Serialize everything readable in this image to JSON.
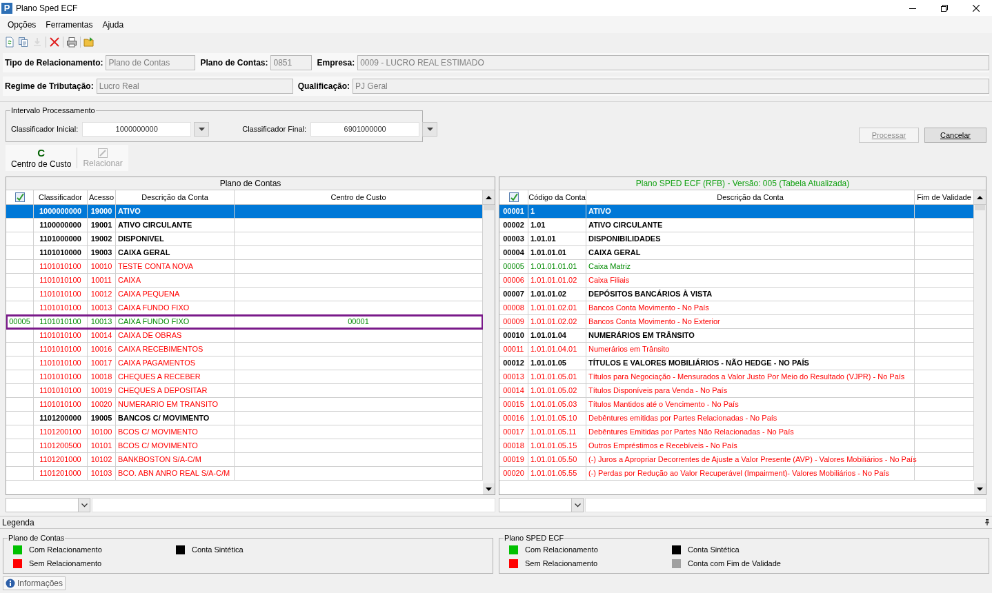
{
  "window": {
    "title": "Plano Sped ECF",
    "logo": "P"
  },
  "menu": [
    "Opções",
    "Ferramentas",
    "Ajuda"
  ],
  "toolbar": [
    {
      "kind": "refresh",
      "disabled": false
    },
    {
      "kind": "copy",
      "disabled": false
    },
    {
      "kind": "download",
      "disabled": true
    },
    {
      "kind": "delete",
      "disabled": false
    },
    {
      "kind": "print",
      "disabled": false
    },
    {
      "kind": "open",
      "disabled": false
    }
  ],
  "header_rows": [
    [
      {
        "label": "Tipo de Relacionamento:",
        "value": "Plano de Contas"
      },
      {
        "label": "Plano de Contas:",
        "value": "0851"
      },
      {
        "label": "Empresa:",
        "value": "0009 - LUCRO REAL ESTIMADO"
      }
    ],
    [
      {
        "label": "Regime de Tributação:",
        "value": "Lucro Real"
      },
      {
        "label": "Qualificação:",
        "value": "PJ Geral"
      }
    ]
  ],
  "interval": {
    "title": "Intervalo Processamento",
    "fields": [
      {
        "label": "Classificador Inicial:",
        "value": "1000000000"
      },
      {
        "label": "Classificador Final:",
        "value": "6901000000"
      }
    ]
  },
  "actions": [
    {
      "label": "Processar",
      "disabled": true
    },
    {
      "label": "Cancelar",
      "disabled": false
    }
  ],
  "tools": [
    {
      "kind": "glyph",
      "glyph": "C",
      "label": "Centro de Custo",
      "disabled": false
    },
    {
      "kind": "icon",
      "label": "Relacionar",
      "disabled": true
    }
  ],
  "left_table": {
    "title": "Plano de Contas",
    "columns": [
      "",
      "Classificador",
      "Acesso",
      "Descrição da Conta",
      "Centro de Custo"
    ],
    "rows": [
      {
        "kind": "synthetic",
        "selected": true,
        "cells": [
          "",
          "1000000000",
          "19000",
          "ATIVO",
          ""
        ]
      },
      {
        "kind": "synthetic",
        "selected": false,
        "cells": [
          "",
          "1100000000",
          "19001",
          "ATIVO CIRCULANTE",
          ""
        ]
      },
      {
        "kind": "synthetic",
        "selected": false,
        "cells": [
          "",
          "1101000000",
          "19002",
          "DISPONIVEL",
          ""
        ]
      },
      {
        "kind": "synthetic",
        "selected": false,
        "cells": [
          "",
          "1101010000",
          "19003",
          "CAIXA GERAL",
          ""
        ]
      },
      {
        "kind": "unrelated",
        "selected": false,
        "cells": [
          "",
          "1101010100",
          "10010",
          "TESTE CONTA NOVA",
          ""
        ]
      },
      {
        "kind": "unrelated",
        "selected": false,
        "cells": [
          "",
          "1101010100",
          "10011",
          "CAIXA",
          ""
        ]
      },
      {
        "kind": "unrelated",
        "selected": false,
        "cells": [
          "",
          "1101010100",
          "10012",
          "CAIXA PEQUENA",
          ""
        ]
      },
      {
        "kind": "unrelated",
        "selected": false,
        "cells": [
          "",
          "1101010100",
          "10013",
          "CAIXA FUNDO FIXO",
          ""
        ]
      },
      {
        "kind": "editing",
        "selected": false,
        "cells": [
          "00005",
          "1101010100",
          "10013",
          "CAIXA FUNDO FIXO",
          "00001"
        ]
      },
      {
        "kind": "unrelated",
        "selected": false,
        "cells": [
          "",
          "1101010100",
          "10014",
          "CAIXA DE OBRAS",
          ""
        ]
      },
      {
        "kind": "unrelated",
        "selected": false,
        "cells": [
          "",
          "1101010100",
          "10016",
          "CAIXA RECEBIMENTOS",
          ""
        ]
      },
      {
        "kind": "unrelated",
        "selected": false,
        "cells": [
          "",
          "1101010100",
          "10017",
          "CAIXA PAGAMENTOS",
          ""
        ]
      },
      {
        "kind": "unrelated",
        "selected": false,
        "cells": [
          "",
          "1101010100",
          "10018",
          "CHEQUES A RECEBER",
          ""
        ]
      },
      {
        "kind": "unrelated",
        "selected": false,
        "cells": [
          "",
          "1101010100",
          "10019",
          "CHEQUES A DEPOSITAR",
          ""
        ]
      },
      {
        "kind": "unrelated",
        "selected": false,
        "cells": [
          "",
          "1101010100",
          "10020",
          "NUMERARIO EM TRANSITO",
          ""
        ]
      },
      {
        "kind": "synthetic",
        "selected": false,
        "cells": [
          "",
          "1101200000",
          "19005",
          "BANCOS C/ MOVIMENTO",
          ""
        ]
      },
      {
        "kind": "unrelated",
        "selected": false,
        "cells": [
          "",
          "1101200100",
          "10100",
          "BCOS C/ MOVIMENTO",
          ""
        ]
      },
      {
        "kind": "unrelated",
        "selected": false,
        "cells": [
          "",
          "1101200500",
          "10101",
          "BCOS C/ MOVIMENTO",
          ""
        ]
      },
      {
        "kind": "unrelated",
        "selected": false,
        "cells": [
          "",
          "1101201000",
          "10102",
          "BANKBOSTON S/A-C/M",
          ""
        ]
      },
      {
        "kind": "unrelated",
        "selected": false,
        "cells": [
          "",
          "1101201000",
          "10103",
          "BCO. ABN ANRO REAL S/A-C/M",
          ""
        ]
      }
    ]
  },
  "right_table": {
    "title": "Plano SPED ECF (RFB) - Versão: 005 (Tabela Atualizada)",
    "columns": [
      "",
      "Código da Conta",
      "Descrição da Conta",
      "Fim de Validade"
    ],
    "rows": [
      {
        "kind": "synthetic",
        "selected": true,
        "cells": [
          "00001",
          "1",
          "ATIVO",
          ""
        ]
      },
      {
        "kind": "synthetic",
        "selected": false,
        "cells": [
          "00002",
          "1.01",
          "ATIVO CIRCULANTE",
          ""
        ]
      },
      {
        "kind": "synthetic",
        "selected": false,
        "cells": [
          "00003",
          "1.01.01",
          "DISPONIBILIDADES",
          ""
        ]
      },
      {
        "kind": "synthetic",
        "selected": false,
        "cells": [
          "00004",
          "1.01.01.01",
          "CAIXA GERAL",
          ""
        ]
      },
      {
        "kind": "related",
        "selected": false,
        "cells": [
          "00005",
          "1.01.01.01.01",
          "Caixa Matriz",
          ""
        ]
      },
      {
        "kind": "unrelated",
        "selected": false,
        "cells": [
          "00006",
          "1.01.01.01.02",
          "Caixa Filiais",
          ""
        ]
      },
      {
        "kind": "synthetic",
        "selected": false,
        "cells": [
          "00007",
          "1.01.01.02",
          "DEPÓSITOS BANCÁRIOS À VISTA",
          ""
        ]
      },
      {
        "kind": "unrelated",
        "selected": false,
        "cells": [
          "00008",
          "1.01.01.02.01",
          "Bancos Conta Movimento - No País",
          ""
        ]
      },
      {
        "kind": "unrelated",
        "selected": false,
        "cells": [
          "00009",
          "1.01.01.02.02",
          "Bancos Conta Movimento - No Exterior",
          ""
        ]
      },
      {
        "kind": "synthetic",
        "selected": false,
        "cells": [
          "00010",
          "1.01.01.04",
          "NUMERÁRIOS EM TRÂNSITO",
          ""
        ]
      },
      {
        "kind": "unrelated",
        "selected": false,
        "cells": [
          "00011",
          "1.01.01.04.01",
          "Numerários em Trânsito",
          ""
        ]
      },
      {
        "kind": "synthetic",
        "selected": false,
        "cells": [
          "00012",
          "1.01.01.05",
          "TÍTULOS E VALORES MOBILIÁRIOS - NÃO HEDGE - NO PAÍS",
          ""
        ]
      },
      {
        "kind": "unrelated",
        "selected": false,
        "cells": [
          "00013",
          "1.01.01.05.01",
          "Títulos para Negociação - Mensurados a Valor Justo Por Meio do Resultado (VJPR) - No País",
          ""
        ]
      },
      {
        "kind": "unrelated",
        "selected": false,
        "cells": [
          "00014",
          "1.01.01.05.02",
          "Títulos Disponíveis para Venda - No País",
          ""
        ]
      },
      {
        "kind": "unrelated",
        "selected": false,
        "cells": [
          "00015",
          "1.01.01.05.03",
          "Títulos Mantidos até o Vencimento - No País",
          ""
        ]
      },
      {
        "kind": "unrelated",
        "selected": false,
        "cells": [
          "00016",
          "1.01.01.05.10",
          "Debêntures emitidas por Partes Relacionadas - No País",
          ""
        ]
      },
      {
        "kind": "unrelated",
        "selected": false,
        "cells": [
          "00017",
          "1.01.01.05.11",
          "Debêntures Emitidas por Partes Não Relacionadas - No País",
          ""
        ]
      },
      {
        "kind": "unrelated",
        "selected": false,
        "cells": [
          "00018",
          "1.01.01.05.15",
          "Outros Empréstimos e Recebíveis - No País",
          ""
        ]
      },
      {
        "kind": "unrelated",
        "selected": false,
        "cells": [
          "00019",
          "1.01.01.05.50",
          "(-) Juros a Apropriar Decorrentes de Ajuste a Valor Presente (AVP) -  Valores Mobiliários - No País",
          ""
        ]
      },
      {
        "kind": "unrelated",
        "selected": false,
        "cells": [
          "00020",
          "1.01.01.05.55",
          "(-) Perdas por Redução ao Valor Recuperável (Impairment)- Valores Mobiliários - No País",
          ""
        ]
      }
    ]
  },
  "legend": {
    "title": "Legenda",
    "groups": [
      {
        "title": "Plano de Contas",
        "items": [
          {
            "label": "Com Relacionamento",
            "color": "#00c000"
          },
          {
            "label": "Conta Sintética",
            "color": "#000000"
          },
          {
            "label": "Sem Relacionamento",
            "color": "#ff0000"
          }
        ]
      },
      {
        "title": "Plano SPED ECF",
        "items": [
          {
            "label": "Com Relacionamento",
            "color": "#00c000"
          },
          {
            "label": "Conta Sintética",
            "color": "#000000"
          },
          {
            "label": "Sem Relacionamento",
            "color": "#ff0000"
          },
          {
            "label": "Conta com Fim de Validade",
            "color": "#a0a0a0"
          }
        ]
      }
    ]
  },
  "bottom_tab": {
    "label": "Informações"
  }
}
